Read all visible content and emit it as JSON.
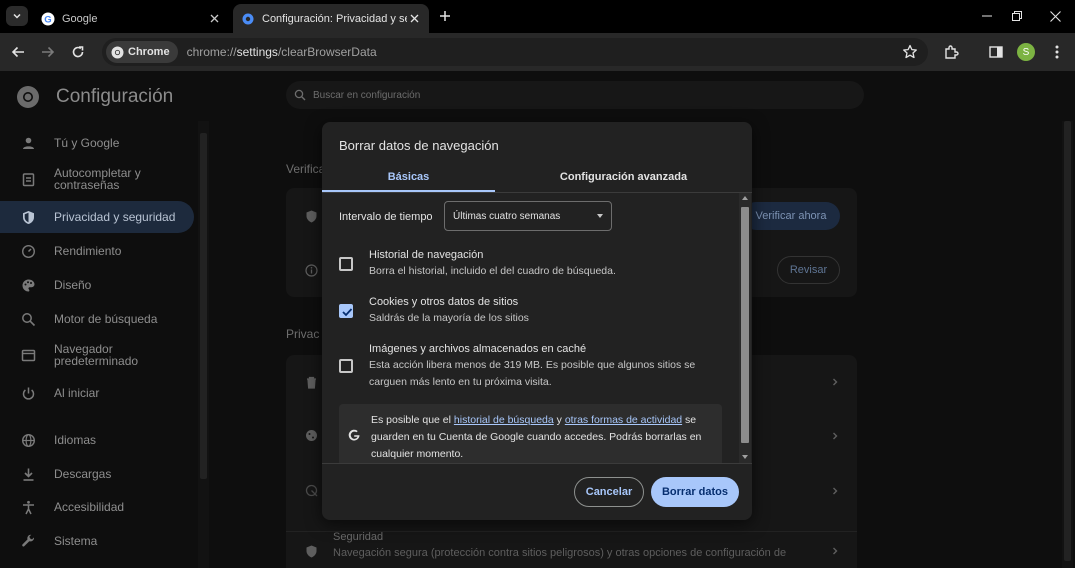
{
  "browser": {
    "tabs": [
      {
        "title": "Google"
      },
      {
        "title": "Configuración: Privacidad y seguridad"
      }
    ],
    "omnibox": {
      "chip_label": "Chrome",
      "url_prefix": "chrome://",
      "url_host": "settings",
      "url_path": "/clearBrowserData"
    },
    "profile_initial": "S"
  },
  "settings": {
    "title": "Configuración",
    "search_placeholder": "Buscar en configuración",
    "nav": [
      {
        "label": "Tú y Google",
        "icon": "person-icon"
      },
      {
        "label": "Autocompletar y contraseñas",
        "icon": "autofill-icon"
      },
      {
        "label": "Privacidad y seguridad",
        "icon": "shield-icon",
        "active": true
      },
      {
        "label": "Rendimiento",
        "icon": "speedometer-icon"
      },
      {
        "label": "Diseño",
        "icon": "palette-icon"
      },
      {
        "label": "Motor de búsqueda",
        "icon": "search-icon"
      },
      {
        "label": "Navegador predeterminado",
        "icon": "browser-icon"
      },
      {
        "label": "Al iniciar",
        "icon": "power-icon"
      },
      {
        "label": "Idiomas",
        "icon": "globe-icon"
      },
      {
        "label": "Descargas",
        "icon": "download-icon"
      },
      {
        "label": "Accesibilidad",
        "icon": "accessibility-icon"
      },
      {
        "label": "Sistema",
        "icon": "wrench-icon"
      }
    ],
    "section_safety_label": "Verifica",
    "verify_now_button": "Verificar ahora",
    "review_button": "Revisar",
    "section_privacy_label": "Privac",
    "security_row": {
      "title": "Seguridad",
      "description": "Navegación segura (protección contra sitios peligrosos) y otras opciones de configuración de"
    }
  },
  "dialog": {
    "title": "Borrar datos de navegación",
    "tabs": {
      "basic": "Básicas",
      "advanced": "Configuración avanzada"
    },
    "time_range_label": "Intervalo de tiempo",
    "time_range_value": "Últimas cuatro semanas",
    "options": [
      {
        "title": "Historial de navegación",
        "description": "Borra el historial, incluido el del cuadro de búsqueda.",
        "checked": false
      },
      {
        "title": "Cookies y otros datos de sitios",
        "description": "Saldrás de la mayoría de los sitios",
        "checked": true
      },
      {
        "title": "Imágenes y archivos almacenados en caché",
        "description": "Esta acción libera menos de 319 MB. Es posible que algunos sitios se carguen más lento en tu próxima visita.",
        "checked": false
      }
    ],
    "info": {
      "text_before": "Es posible que el ",
      "link1": "historial de búsqueda",
      "text_mid": " y ",
      "link2": "otras formas de actividad",
      "text_after": " se guarden en tu Cuenta de Google cuando accedes. Podrás borrarlas en cualquier momento."
    },
    "cancel_button": "Cancelar",
    "confirm_button": "Borrar datos"
  }
}
